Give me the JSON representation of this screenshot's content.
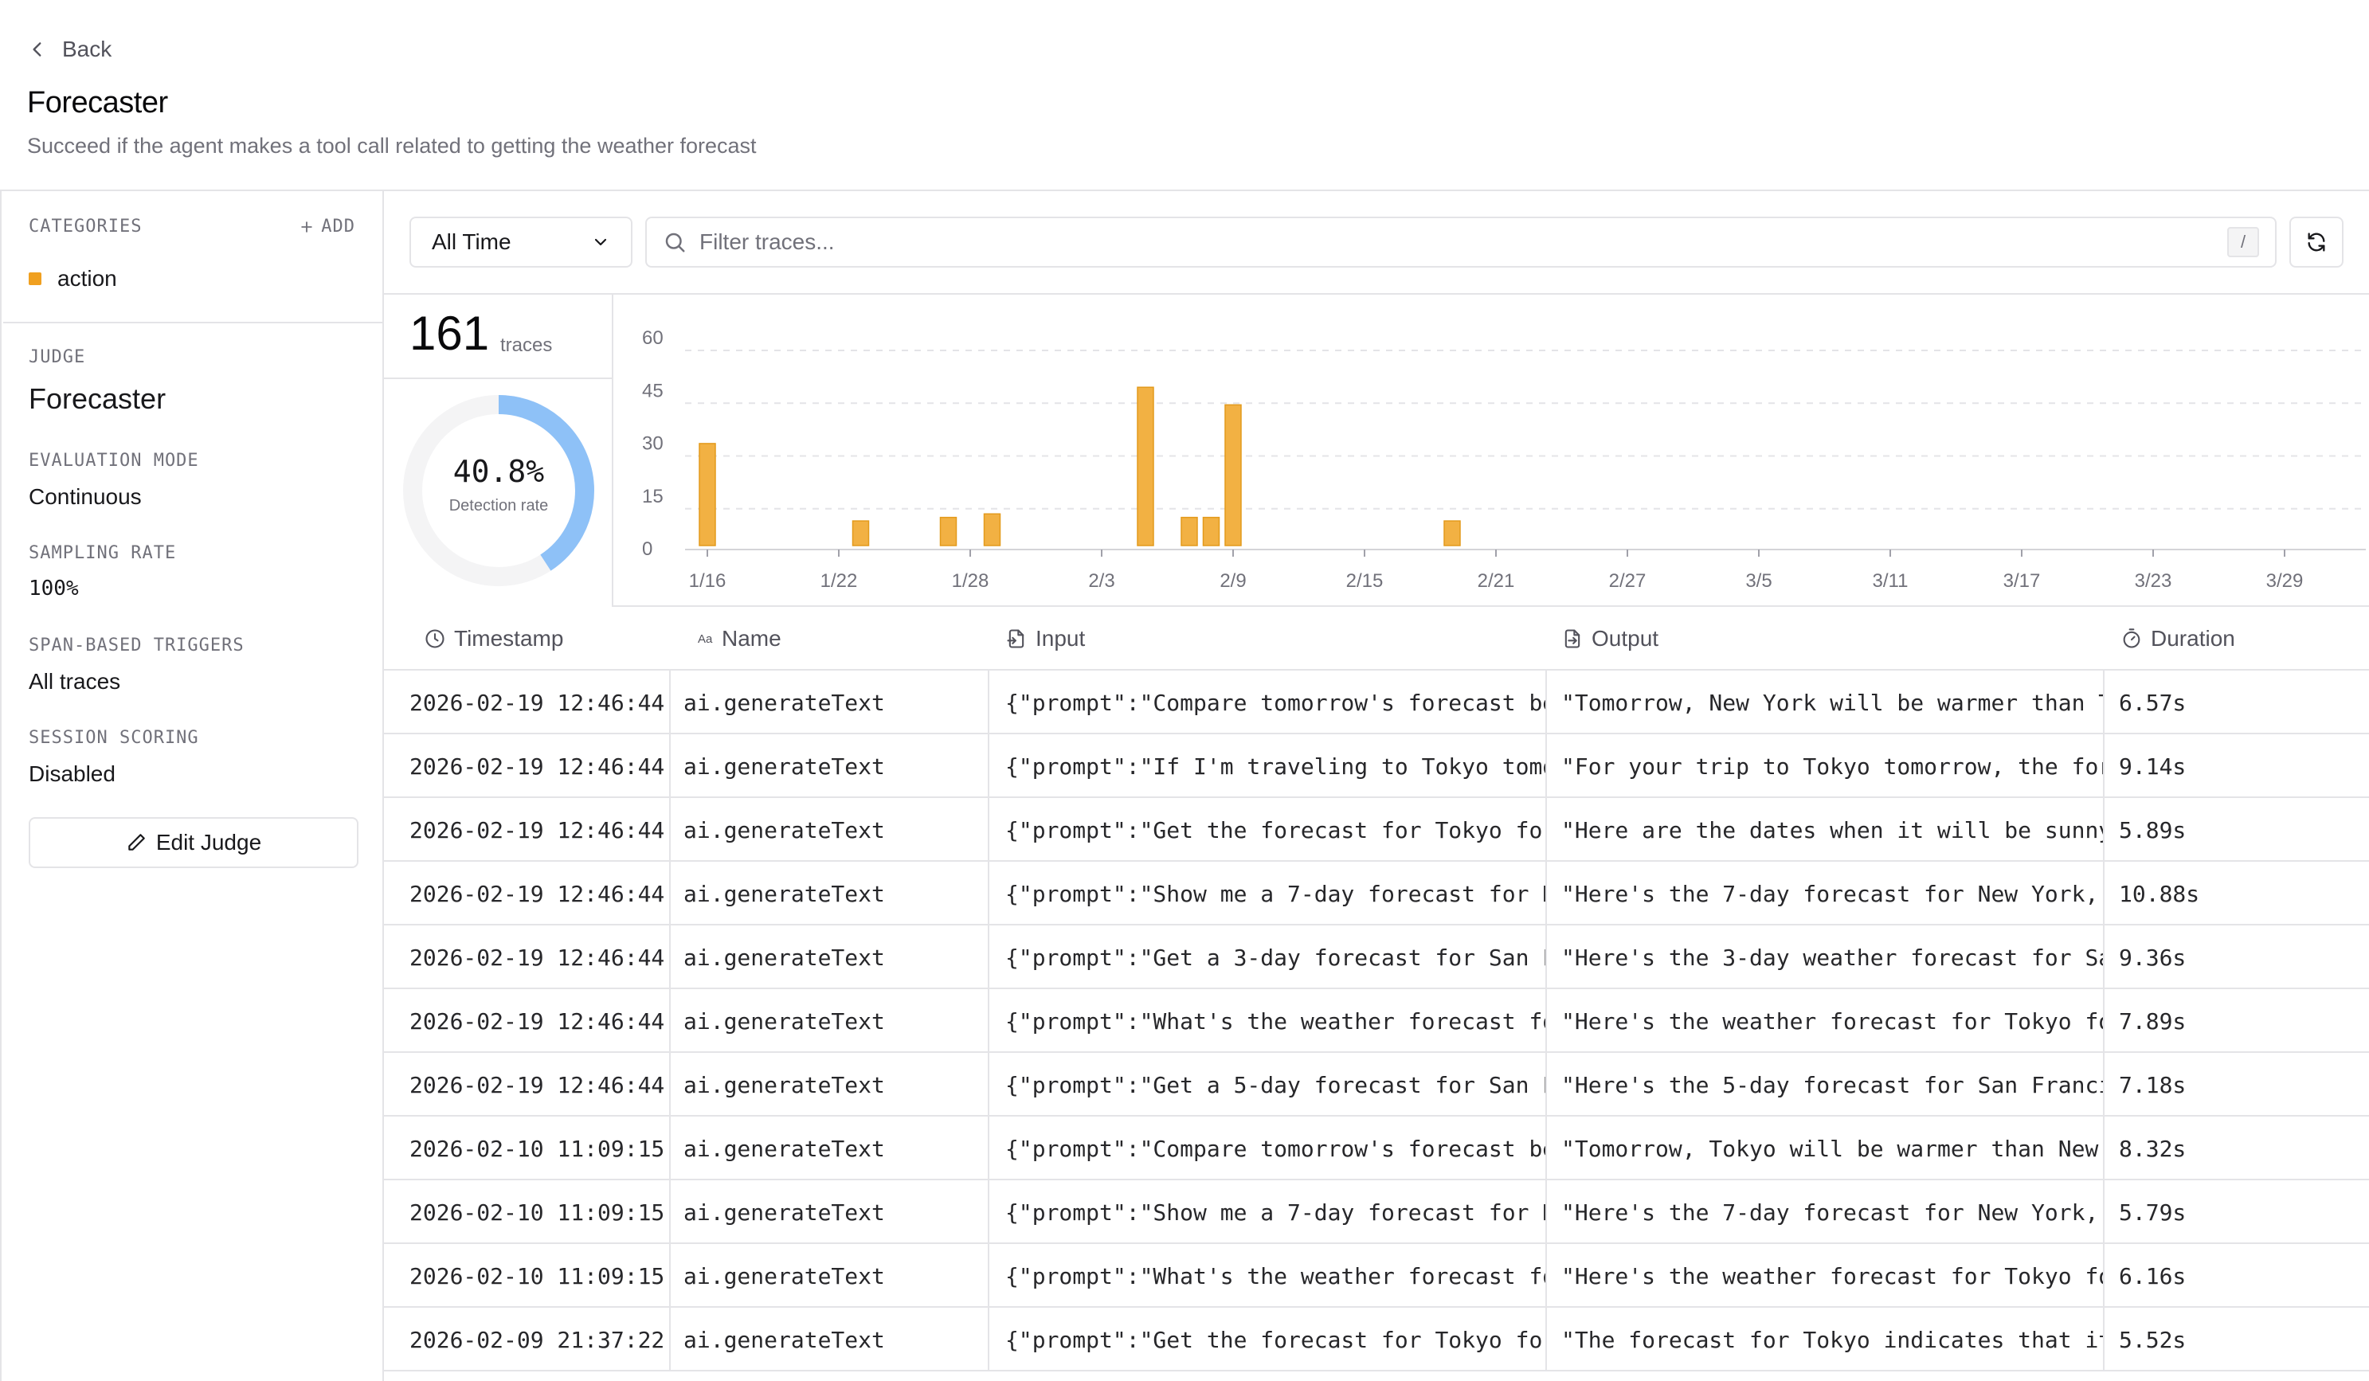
{
  "header": {
    "back_label": "Back",
    "title": "Forecaster",
    "subtitle": "Succeed if the agent makes a tool call related to getting the weather forecast"
  },
  "sidebar": {
    "categories_label": "CATEGORIES",
    "add_label": "ADD",
    "categories": [
      {
        "name": "action",
        "color": "#f0a020"
      }
    ],
    "judge_label": "JUDGE",
    "judge_value": "Forecaster",
    "eval_mode_label": "EVALUATION MODE",
    "eval_mode_value": "Continuous",
    "sampling_label": "SAMPLING RATE",
    "sampling_value": "100%",
    "triggers_label": "SPAN-BASED TRIGGERS",
    "triggers_value": "All traces",
    "session_label": "SESSION SCORING",
    "session_value": "Disabled",
    "edit_button": "Edit Judge"
  },
  "toolbar": {
    "time_range": "All Time",
    "filter_placeholder": "Filter traces...",
    "shortcut": "/"
  },
  "stats": {
    "trace_count": "161",
    "trace_word": "traces",
    "detection_rate_text": "40.8%",
    "detection_rate": 0.408,
    "detection_label": "Detection rate",
    "ring_color": "#8ec1f7"
  },
  "chart_data": {
    "type": "bar",
    "ylim": [
      0,
      60
    ],
    "yticks": [
      0,
      15,
      30,
      45,
      60
    ],
    "x_range": [
      "1/16",
      "3/31"
    ],
    "xticks": [
      "1/16",
      "1/22",
      "1/28",
      "2/3",
      "2/9",
      "2/15",
      "2/21",
      "2/27",
      "3/5",
      "3/11",
      "3/17",
      "3/23",
      "3/29"
    ],
    "bar_color": "#f2b143",
    "points": [
      {
        "x": "1/16",
        "value": 29
      },
      {
        "x": "1/23",
        "value": 7
      },
      {
        "x": "1/27",
        "value": 8
      },
      {
        "x": "1/29",
        "value": 9
      },
      {
        "x": "2/5",
        "value": 45
      },
      {
        "x": "2/7",
        "value": 8
      },
      {
        "x": "2/8",
        "value": 8
      },
      {
        "x": "2/9",
        "value": 40
      },
      {
        "x": "2/19",
        "value": 7
      }
    ]
  },
  "table": {
    "columns": [
      "Timestamp",
      "Name",
      "Input",
      "Output",
      "Duration"
    ],
    "rows": [
      {
        "ts": "2026-02-19 12:46:44",
        "name": "ai.generateText",
        "input": "{\"prompt\":\"Compare tomorrow's forecast be",
        "output": "\"Tomorrow, New York will be warmer than T",
        "dur": "6.57s"
      },
      {
        "ts": "2026-02-19 12:46:44",
        "name": "ai.generateText",
        "input": "{\"prompt\":\"If I'm traveling to Tokyo tomo",
        "output": "\"For your trip to Tokyo tomorrow, the for",
        "dur": "9.14s"
      },
      {
        "ts": "2026-02-19 12:46:44",
        "name": "ai.generateText",
        "input": "{\"prompt\":\"Get the forecast for Tokyo for",
        "output": "\"Here are the dates when it will be sunny",
        "dur": "5.89s"
      },
      {
        "ts": "2026-02-19 12:46:44",
        "name": "ai.generateText",
        "input": "{\"prompt\":\"Show me a 7-day forecast for N",
        "output": "\"Here's the 7-day forecast for New York,",
        "dur": "10.88s"
      },
      {
        "ts": "2026-02-19 12:46:44",
        "name": "ai.generateText",
        "input": "{\"prompt\":\"Get a 3-day forecast for San F",
        "output": "\"Here's the 3-day weather forecast for Sa",
        "dur": "9.36s"
      },
      {
        "ts": "2026-02-19 12:46:44",
        "name": "ai.generateText",
        "input": "{\"prompt\":\"What's the weather forecast fo",
        "output": "\"Here's the weather forecast for Tokyo fo",
        "dur": "7.89s"
      },
      {
        "ts": "2026-02-19 12:46:44",
        "name": "ai.generateText",
        "input": "{\"prompt\":\"Get a 5-day forecast for San F",
        "output": "\"Here's the 5-day forecast for San Franci",
        "dur": "7.18s"
      },
      {
        "ts": "2026-02-10 11:09:15",
        "name": "ai.generateText",
        "input": "{\"prompt\":\"Compare tomorrow's forecast be",
        "output": "\"Tomorrow, Tokyo will be warmer than New",
        "dur": "8.32s"
      },
      {
        "ts": "2026-02-10 11:09:15",
        "name": "ai.generateText",
        "input": "{\"prompt\":\"Show me a 7-day forecast for N",
        "output": "\"Here's the 7-day forecast for New York,",
        "dur": "5.79s"
      },
      {
        "ts": "2026-02-10 11:09:15",
        "name": "ai.generateText",
        "input": "{\"prompt\":\"What's the weather forecast fo",
        "output": "\"Here's the weather forecast for Tokyo fo",
        "dur": "6.16s"
      },
      {
        "ts": "2026-02-09 21:37:22",
        "name": "ai.generateText",
        "input": "{\"prompt\":\"Get the forecast for Tokyo for",
        "output": "\"The forecast for Tokyo indicates that it",
        "dur": "5.52s"
      }
    ]
  }
}
